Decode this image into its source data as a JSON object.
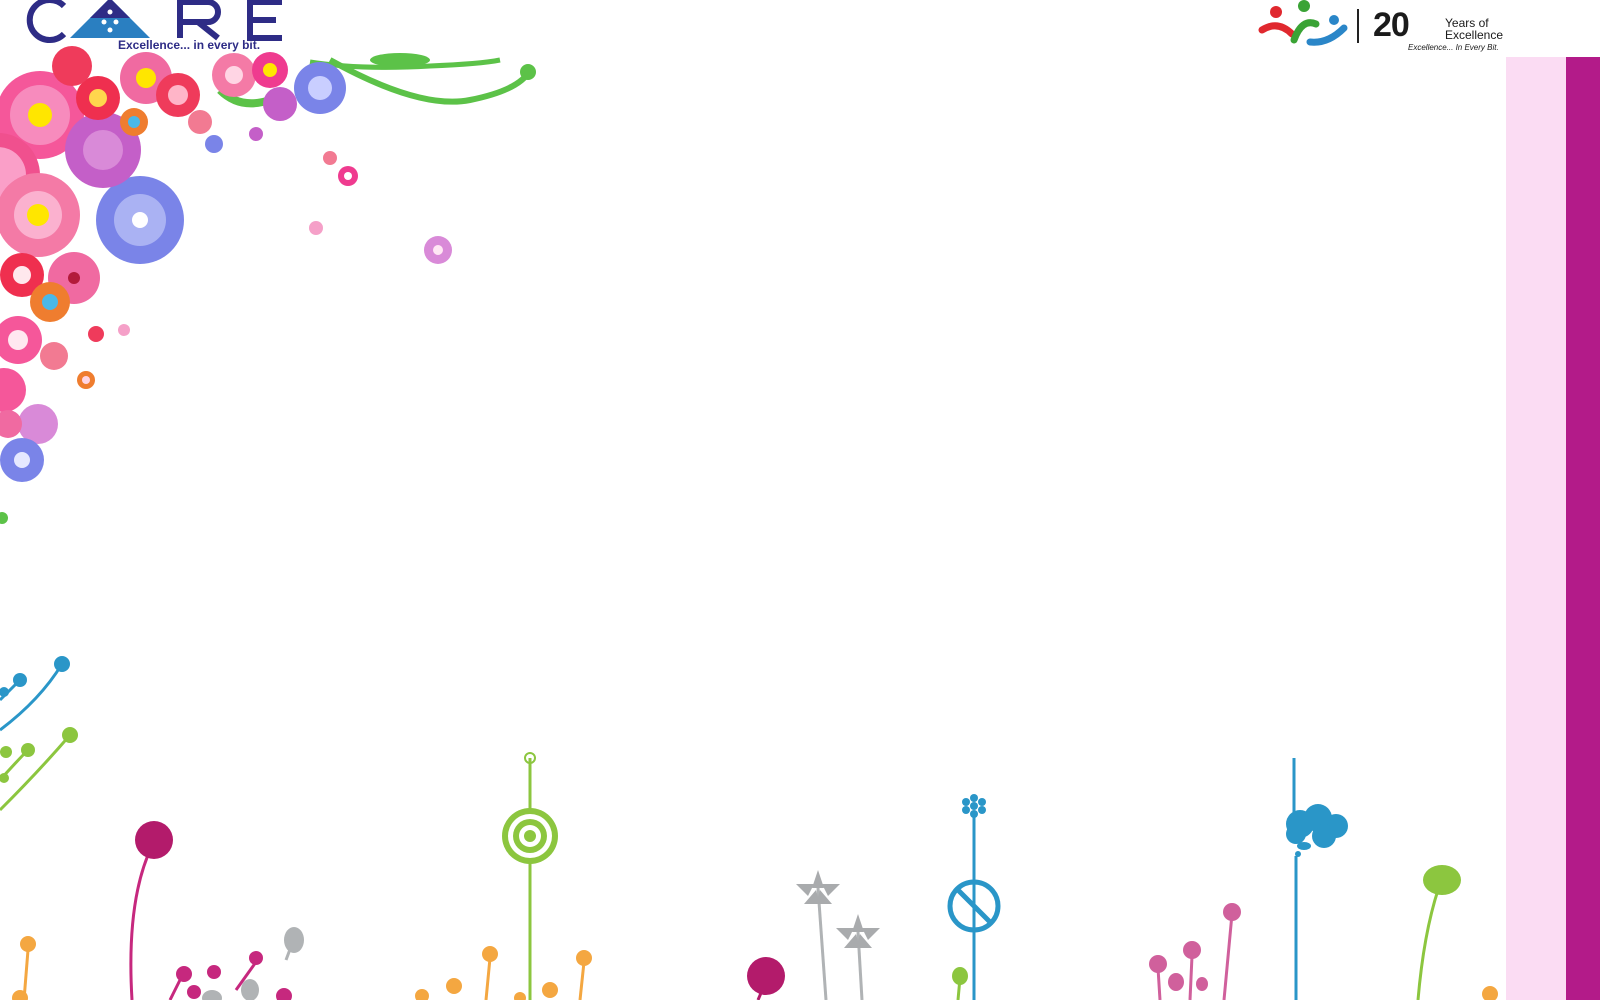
{
  "logo": {
    "name": "CARE",
    "tagline": "Excellence... in every bit.",
    "brand_color": "#2e2c86"
  },
  "anniversary": {
    "number": "20",
    "text": "Years of Excellence",
    "tagline": "Excellence... In Every Bit."
  },
  "colors": {
    "side_band_light": "#fbdcf3",
    "side_band_dark": "#b31b89"
  }
}
